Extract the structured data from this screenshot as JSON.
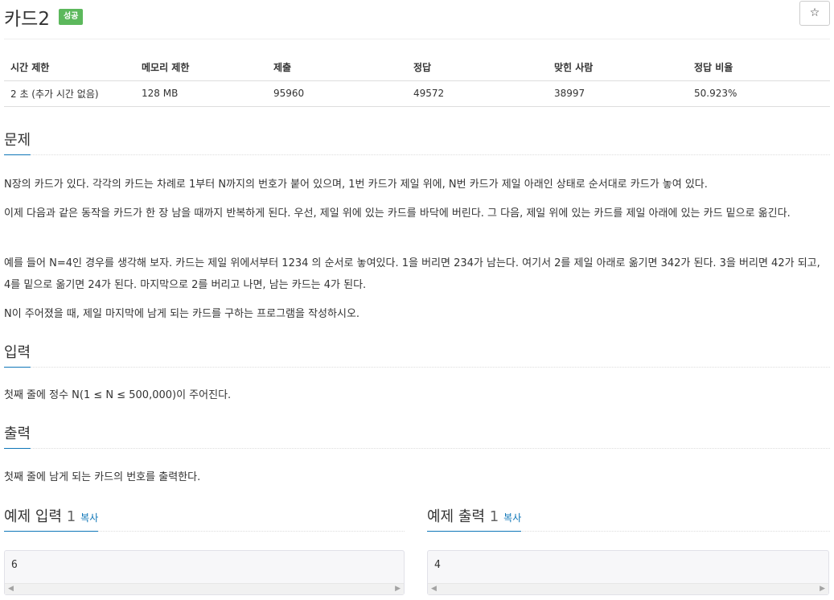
{
  "header": {
    "title": "카드2",
    "badge": "성공",
    "star_glyph": "☆"
  },
  "info_table": {
    "columns": [
      "시간 제한",
      "메모리 제한",
      "제출",
      "정답",
      "맞힌 사람",
      "정답 비율"
    ],
    "row": [
      "2 초 (추가 시간 없음)",
      "128 MB",
      "95960",
      "49572",
      "38997",
      "50.923%"
    ]
  },
  "problem": {
    "title": "문제",
    "paragraphs": [
      "N장의 카드가 있다. 각각의 카드는 차례로 1부터 N까지의 번호가 붙어 있으며, 1번 카드가 제일 위에, N번 카드가 제일 아래인 상태로 순서대로 카드가 놓여 있다.",
      "이제 다음과 같은 동작을 카드가 한 장 남을 때까지 반복하게 된다. 우선, 제일 위에 있는 카드를 바닥에 버린다. 그 다음, 제일 위에 있는 카드를 제일 아래에 있는 카드 밑으로 옮긴다.",
      "예를 들어 N=4인 경우를 생각해 보자. 카드는 제일 위에서부터 1234 의 순서로 놓여있다. 1을 버리면 234가 남는다. 여기서 2를 제일 아래로 옮기면 342가 된다. 3을 버리면 42가 되고, 4를 밑으로 옮기면 24가 된다. 마지막으로 2를 버리고 나면, 남는 카드는 4가 된다.",
      "N이 주어졌을 때, 제일 마지막에 남게 되는 카드를 구하는 프로그램을 작성하시오."
    ]
  },
  "input": {
    "title": "입력",
    "text": "첫째 줄에 정수 N(1 ≤ N ≤ 500,000)이 주어진다."
  },
  "output": {
    "title": "출력",
    "text": "첫째 줄에 남게 되는 카드의 번호를 출력한다."
  },
  "sample_input": {
    "title": "예제 입력",
    "number": "1",
    "copy_label": "복사",
    "value": "6"
  },
  "sample_output": {
    "title": "예제 출력",
    "number": "1",
    "copy_label": "복사",
    "value": "4"
  },
  "scroll": {
    "left_glyph": "◀",
    "right_glyph": "▶"
  }
}
